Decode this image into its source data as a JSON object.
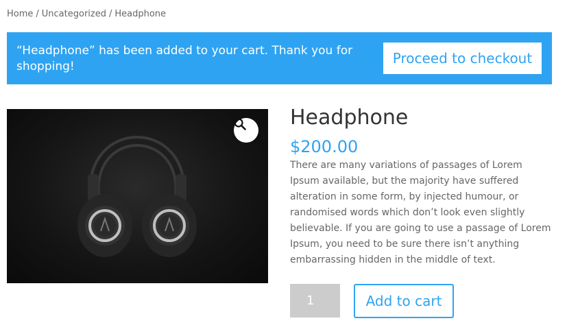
{
  "breadcrumb": {
    "items": [
      "Home",
      "Uncategorized",
      "Headphone"
    ],
    "separator": "/"
  },
  "notice": {
    "message": "“Headphone” has been added to your cart. Thank you for shopping!",
    "checkout_label": "Proceed to checkout",
    "background_color": "#2ea3f2"
  },
  "product": {
    "title": "Headphone",
    "price": "$200.00",
    "description": "There are many variations of passages of Lorem Ipsum available, but the majority have suffered alteration in some form, by injected humour, or randomised words which don’t look even slightly believable. If you are going to use a passage of Lorem Ipsum, you need to be sure there isn’t anything embarrassing hidden in the middle of text.",
    "image_alt": "Headphone",
    "zoom_icon": "magnifier-icon"
  },
  "cart_form": {
    "quantity": "1",
    "add_to_cart_label": "Add to cart"
  },
  "colors": {
    "accent": "#2ea3f2",
    "text": "#666666",
    "heading": "#333333"
  }
}
